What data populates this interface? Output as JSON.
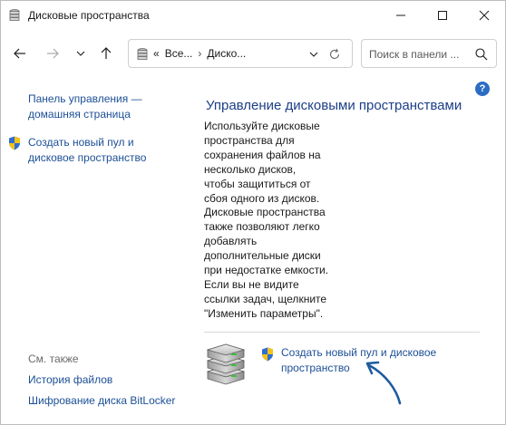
{
  "window": {
    "title": "Дисковые пространства",
    "icon": "storage-spaces-icon"
  },
  "navbar": {
    "breadcrumbs": [
      "«",
      "Все...",
      "Диско..."
    ],
    "search_placeholder": "Поиск в панели ..."
  },
  "help": {
    "label": "?"
  },
  "left_pane": {
    "home_link": "Панель управления —\nдомашняя страница",
    "create_link": "Создать новый пул и\nдисковое пространство",
    "see_also": "См. также",
    "links": [
      "История файлов",
      "Шифрование диска BitLocker"
    ]
  },
  "main": {
    "title": "Управление дисковыми пространствами",
    "description": "Используйте дисковые\nпространства для\nсохранения файлов на\nнесколько дисков,\nчтобы защититься от\nсбоя одного из дисков.\nДисковые пространства\nтакже позволяют легко\nдобавлять\nдополнительные диски\nпри недостатке емкости.\nЕсли вы не видите\nссылки задач, щелкните\n\"Изменить параметры\".",
    "task_link": "Создать новый пул и дисковое\nпространство"
  },
  "colors": {
    "link": "#1c4f96",
    "title": "#1c3f86",
    "help": "#2b6cc4",
    "arrow": "#1f5aa0"
  }
}
